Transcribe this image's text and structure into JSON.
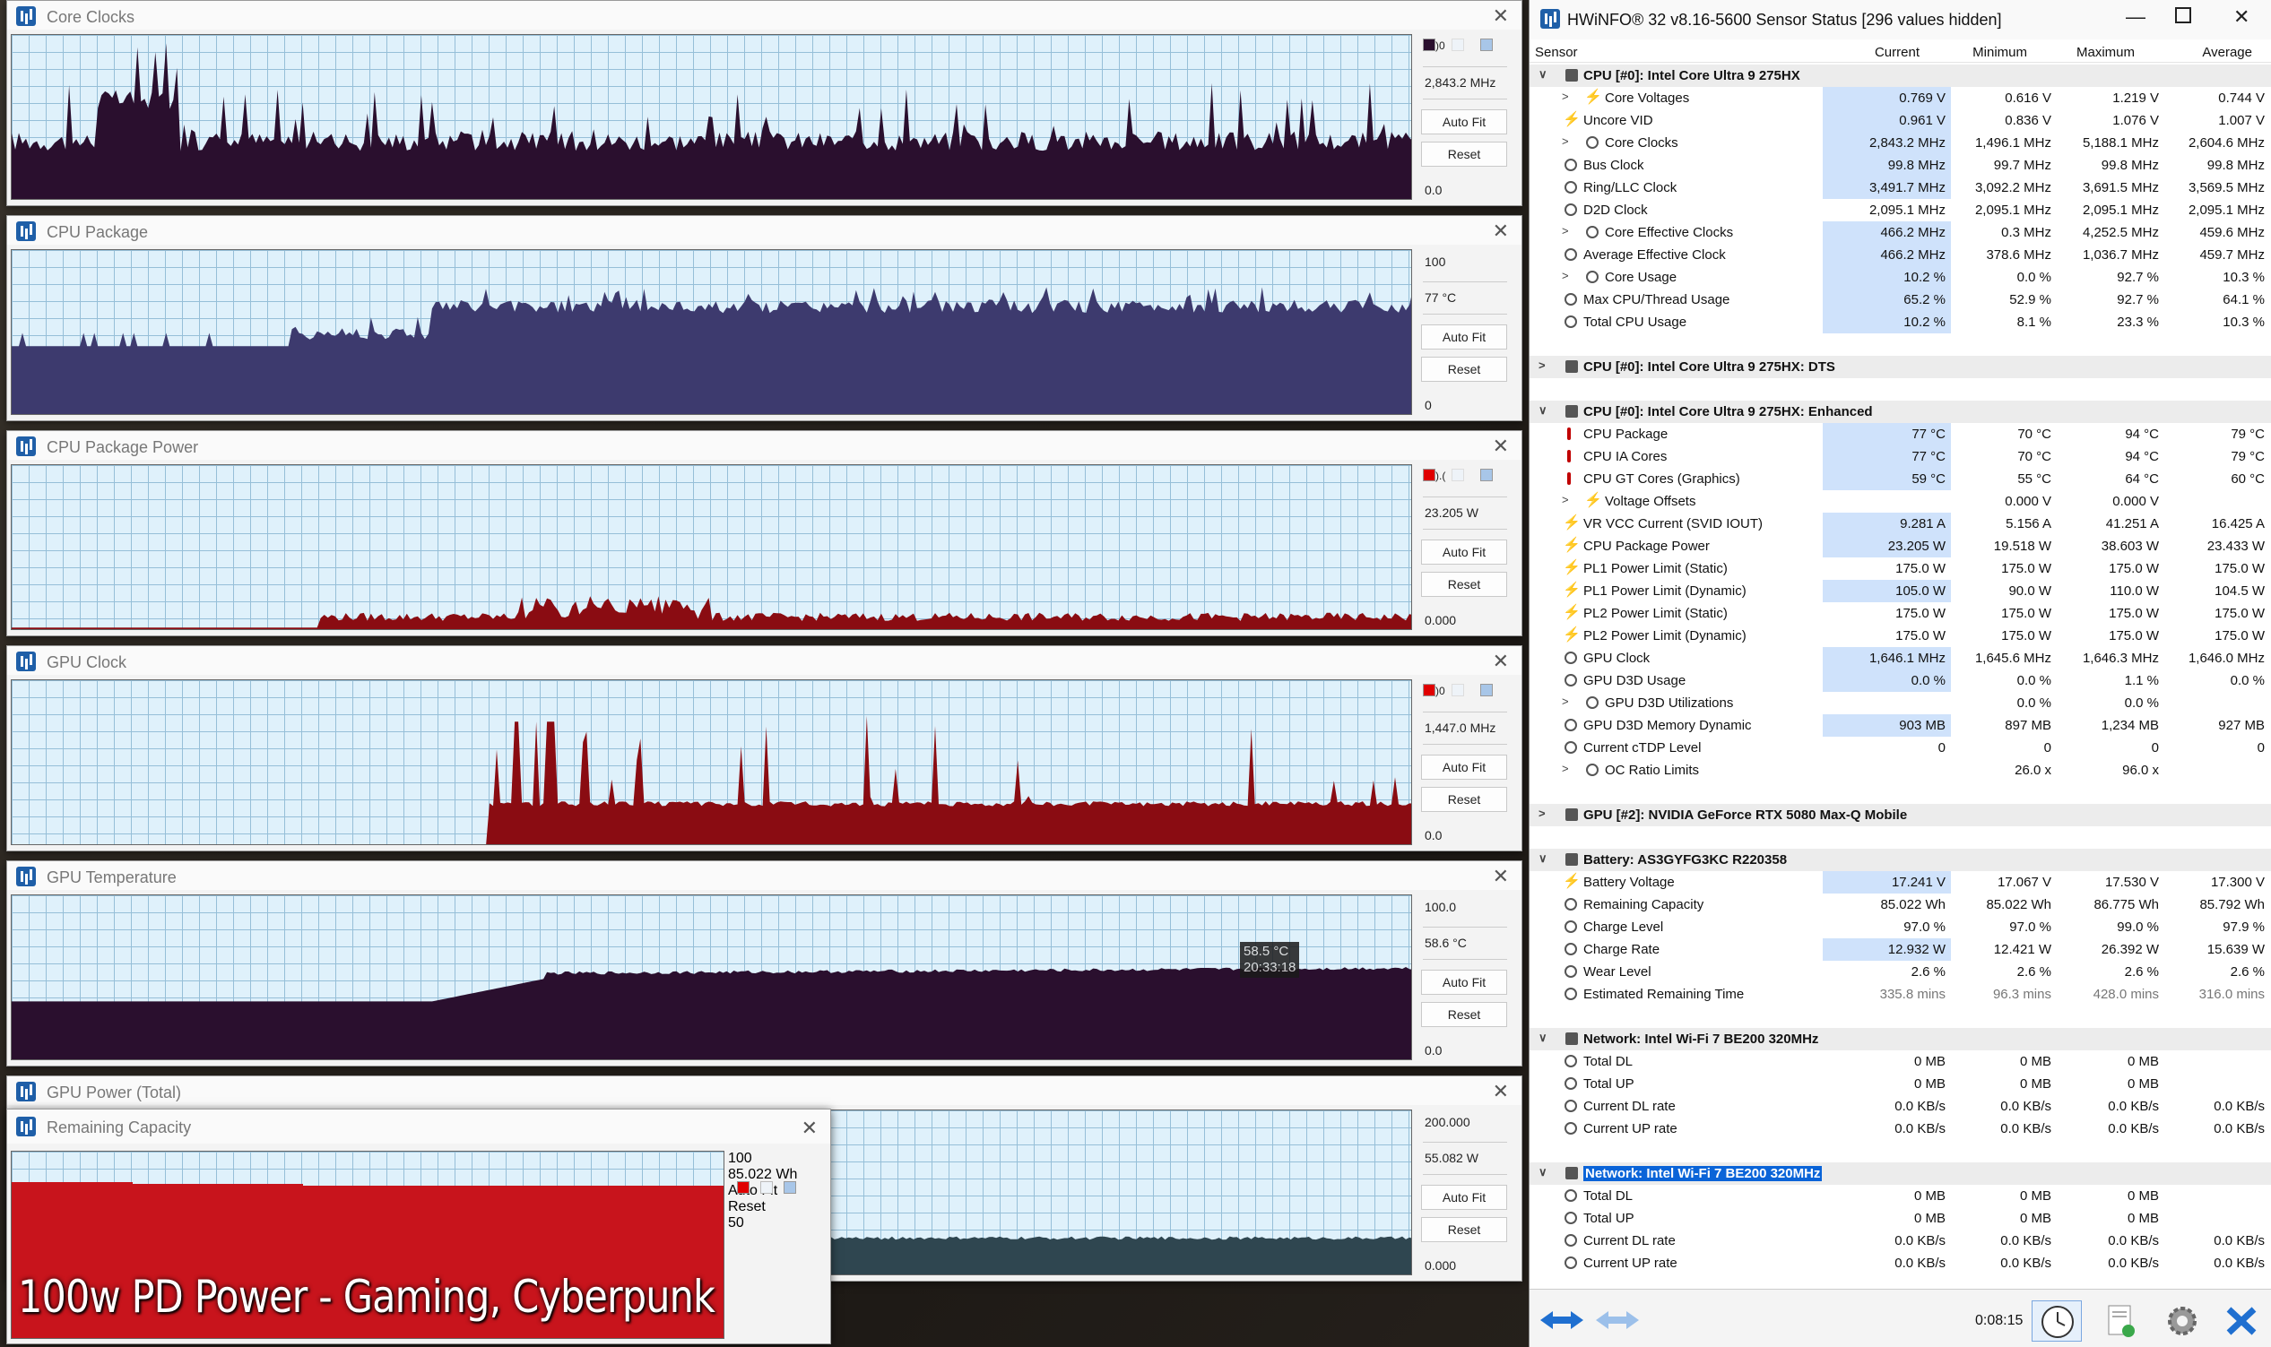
{
  "graphs": [
    {
      "title": "Core Clocks",
      "top_value": "",
      "current_value": "2,843.2 MHz",
      "bottom_value": "0.0",
      "color": "#2a0f2e",
      "auto_fit": "Auto Fit",
      "reset": "Reset",
      "top_label_fragment": ")0"
    },
    {
      "title": "CPU Package",
      "top_value": "100",
      "current_value": "77 °C",
      "bottom_value": "0",
      "color": "#3d3a6e",
      "auto_fit": "Auto Fit",
      "reset": "Reset",
      "top_label_fragment": ""
    },
    {
      "title": "CPU Package Power",
      "top_value": "",
      "current_value": "23.205 W",
      "bottom_value": "0.000",
      "color": "#8a0c12",
      "auto_fit": "Auto Fit",
      "reset": "Reset",
      "top_label_fragment": ").("
    },
    {
      "title": "GPU Clock",
      "top_value": "",
      "current_value": "1,447.0 MHz",
      "bottom_value": "0.0",
      "color": "#8a0c12",
      "auto_fit": "Auto Fit",
      "reset": "Reset",
      "top_label_fragment": ")0"
    },
    {
      "title": "GPU Temperature",
      "top_value": "100.0",
      "current_value": "58.6 °C",
      "bottom_value": "0.0",
      "color": "#2a0f2e",
      "auto_fit": "Auto Fit",
      "reset": "Reset",
      "top_label_fragment": "",
      "tooltip_value": "58.5 °C",
      "tooltip_time": "20:33:18"
    },
    {
      "title": "GPU Power (Total)",
      "top_value": "200.000",
      "current_value": "55.082 W",
      "bottom_value": "0.000",
      "color": "#2f4650",
      "auto_fit": "Auto Fit",
      "reset": "Reset",
      "top_label_fragment": ""
    }
  ],
  "remaining_capacity": {
    "title": "Remaining Capacity",
    "top_value": "100",
    "current_value": "85.022 Wh",
    "bottom_value": "50",
    "auto_fit": "Auto Fit",
    "reset": "Reset",
    "color": "#c8141c"
  },
  "caption": "100w PD Power - Gaming, Cyberpunk",
  "sensor_window": {
    "title": "HWiNFO® 32 v8.16-5600 Sensor Status [296 values hidden]",
    "columns": [
      "Sensor",
      "Current",
      "Minimum",
      "Maximum",
      "Average"
    ],
    "rows": [
      {
        "type": "grp",
        "exp": "∨",
        "label": "CPU [#0]: Intel Core Ultra 9 275HX"
      },
      {
        "type": "sub",
        "exp": ">",
        "icon": "bolt",
        "label": "Core Voltages",
        "cur": "0.769 V",
        "min": "0.616 V",
        "max": "1.219 V",
        "avg": "0.744 V",
        "hl": true
      },
      {
        "type": "item",
        "icon": "bolt",
        "label": "Uncore VID",
        "cur": "0.961 V",
        "min": "0.836 V",
        "max": "1.076 V",
        "avg": "1.007 V",
        "hl": true
      },
      {
        "type": "sub",
        "exp": ">",
        "icon": "clock",
        "label": "Core Clocks",
        "cur": "2,843.2 MHz",
        "min": "1,496.1 MHz",
        "max": "5,188.1 MHz",
        "avg": "2,604.6 MHz",
        "hl": true
      },
      {
        "type": "item",
        "icon": "clock",
        "label": "Bus Clock",
        "cur": "99.8 MHz",
        "min": "99.7 MHz",
        "max": "99.8 MHz",
        "avg": "99.8 MHz",
        "hl": true
      },
      {
        "type": "item",
        "icon": "clock",
        "label": "Ring/LLC Clock",
        "cur": "3,491.7 MHz",
        "min": "3,092.2 MHz",
        "max": "3,691.5 MHz",
        "avg": "3,569.5 MHz",
        "hl": true
      },
      {
        "type": "item",
        "icon": "clock",
        "label": "D2D Clock",
        "cur": "2,095.1 MHz",
        "min": "2,095.1 MHz",
        "max": "2,095.1 MHz",
        "avg": "2,095.1 MHz",
        "hl": false
      },
      {
        "type": "sub",
        "exp": ">",
        "icon": "clock",
        "label": "Core Effective Clocks",
        "cur": "466.2 MHz",
        "min": "0.3 MHz",
        "max": "4,252.5 MHz",
        "avg": "459.6 MHz",
        "hl": true
      },
      {
        "type": "item",
        "icon": "clock",
        "label": "Average Effective Clock",
        "cur": "466.2 MHz",
        "min": "378.6 MHz",
        "max": "1,036.7 MHz",
        "avg": "459.7 MHz",
        "hl": true
      },
      {
        "type": "sub",
        "exp": ">",
        "icon": "clock",
        "label": "Core Usage",
        "cur": "10.2 %",
        "min": "0.0 %",
        "max": "92.7 %",
        "avg": "10.3 %",
        "hl": true
      },
      {
        "type": "item",
        "icon": "clock",
        "label": "Max CPU/Thread Usage",
        "cur": "65.2 %",
        "min": "52.9 %",
        "max": "92.7 %",
        "avg": "64.1 %",
        "hl": true
      },
      {
        "type": "item",
        "icon": "clock",
        "label": "Total CPU Usage",
        "cur": "10.2 %",
        "min": "8.1 %",
        "max": "23.3 %",
        "avg": "10.3 %",
        "hl": true
      },
      {
        "type": "blank"
      },
      {
        "type": "grp",
        "exp": ">",
        "label": "CPU [#0]: Intel Core Ultra 9 275HX: DTS"
      },
      {
        "type": "blank"
      },
      {
        "type": "grp",
        "exp": "∨",
        "label": "CPU [#0]: Intel Core Ultra 9 275HX: Enhanced"
      },
      {
        "type": "item",
        "icon": "therm",
        "label": "CPU Package",
        "cur": "77 °C",
        "min": "70 °C",
        "max": "94 °C",
        "avg": "79 °C",
        "hl": true
      },
      {
        "type": "item",
        "icon": "therm",
        "label": "CPU IA Cores",
        "cur": "77 °C",
        "min": "70 °C",
        "max": "94 °C",
        "avg": "79 °C",
        "hl": true
      },
      {
        "type": "item",
        "icon": "therm",
        "label": "CPU GT Cores (Graphics)",
        "cur": "59 °C",
        "min": "55 °C",
        "max": "64 °C",
        "avg": "60 °C",
        "hl": true
      },
      {
        "type": "sub",
        "exp": ">",
        "icon": "bolt",
        "label": "Voltage Offsets",
        "cur": "",
        "min": "0.000 V",
        "max": "0.000 V",
        "avg": "",
        "hl": false
      },
      {
        "type": "item",
        "icon": "bolt",
        "label": "VR VCC Current (SVID IOUT)",
        "cur": "9.281 A",
        "min": "5.156 A",
        "max": "41.251 A",
        "avg": "16.425 A",
        "hl": true
      },
      {
        "type": "item",
        "icon": "bolt",
        "label": "CPU Package Power",
        "cur": "23.205 W",
        "min": "19.518 W",
        "max": "38.603 W",
        "avg": "23.433 W",
        "hl": true
      },
      {
        "type": "item",
        "icon": "bolt",
        "label": "PL1 Power Limit (Static)",
        "cur": "175.0 W",
        "min": "175.0 W",
        "max": "175.0 W",
        "avg": "175.0 W",
        "hl": false
      },
      {
        "type": "item",
        "icon": "bolt",
        "label": "PL1 Power Limit (Dynamic)",
        "cur": "105.0 W",
        "min": "90.0 W",
        "max": "110.0 W",
        "avg": "104.5 W",
        "hl": true
      },
      {
        "type": "item",
        "icon": "bolt",
        "label": "PL2 Power Limit (Static)",
        "cur": "175.0 W",
        "min": "175.0 W",
        "max": "175.0 W",
        "avg": "175.0 W",
        "hl": false
      },
      {
        "type": "item",
        "icon": "bolt",
        "label": "PL2 Power Limit (Dynamic)",
        "cur": "175.0 W",
        "min": "175.0 W",
        "max": "175.0 W",
        "avg": "175.0 W",
        "hl": false
      },
      {
        "type": "item",
        "icon": "clock",
        "label": "GPU Clock",
        "cur": "1,646.1 MHz",
        "min": "1,645.6 MHz",
        "max": "1,646.3 MHz",
        "avg": "1,646.0 MHz",
        "hl": true
      },
      {
        "type": "item",
        "icon": "clock",
        "label": "GPU D3D Usage",
        "cur": "0.0 %",
        "min": "0.0 %",
        "max": "1.1 %",
        "avg": "0.0 %",
        "hl": true
      },
      {
        "type": "sub",
        "exp": ">",
        "icon": "clock",
        "label": "GPU D3D Utilizations",
        "cur": "",
        "min": "0.0 %",
        "max": "0.0 %",
        "avg": "",
        "hl": false
      },
      {
        "type": "item",
        "icon": "clock",
        "label": "GPU D3D Memory Dynamic",
        "cur": "903 MB",
        "min": "897 MB",
        "max": "1,234 MB",
        "avg": "927 MB",
        "hl": true
      },
      {
        "type": "item",
        "icon": "clock",
        "label": "Current cTDP Level",
        "cur": "0",
        "min": "0",
        "max": "0",
        "avg": "0",
        "hl": false
      },
      {
        "type": "sub",
        "exp": ">",
        "icon": "clock",
        "label": "OC Ratio Limits",
        "cur": "",
        "min": "26.0 x",
        "max": "96.0 x",
        "avg": "",
        "hl": false
      },
      {
        "type": "blank"
      },
      {
        "type": "grp",
        "exp": ">",
        "label": "GPU [#2]: NVIDIA  GeForce RTX 5080 Max-Q Mobile"
      },
      {
        "type": "blank"
      },
      {
        "type": "grp",
        "exp": "∨",
        "label": "Battery: AS3GYFG3KC R220358"
      },
      {
        "type": "item",
        "icon": "bolt",
        "label": "Battery Voltage",
        "cur": "17.241 V",
        "min": "17.067 V",
        "max": "17.530 V",
        "avg": "17.300 V",
        "hl": true
      },
      {
        "type": "item",
        "icon": "clock",
        "label": "Remaining Capacity",
        "cur": "85.022 Wh",
        "min": "85.022 Wh",
        "max": "86.775 Wh",
        "avg": "85.792 Wh",
        "hl": false
      },
      {
        "type": "item",
        "icon": "clock",
        "label": "Charge Level",
        "cur": "97.0 %",
        "min": "97.0 %",
        "max": "99.0 %",
        "avg": "97.9 %",
        "hl": false
      },
      {
        "type": "item",
        "icon": "clock",
        "label": "Charge Rate",
        "cur": "12.932 W",
        "min": "12.421 W",
        "max": "26.392 W",
        "avg": "15.639 W",
        "hl": true
      },
      {
        "type": "item",
        "icon": "clock",
        "label": "Wear Level",
        "cur": "2.6 %",
        "min": "2.6 %",
        "max": "2.6 %",
        "avg": "2.6 %",
        "hl": false
      },
      {
        "type": "item",
        "icon": "clock",
        "label": "Estimated Remaining Time",
        "cur": "335.8 mins",
        "min": "96.3 mins",
        "max": "428.0 mins",
        "avg": "316.0 mins",
        "hl": false,
        "dim": true
      },
      {
        "type": "blank"
      },
      {
        "type": "grp",
        "exp": "∨",
        "label": "Network: Intel Wi-Fi 7 BE200 320MHz"
      },
      {
        "type": "item",
        "icon": "clock",
        "label": "Total DL",
        "cur": "0 MB",
        "min": "0 MB",
        "max": "0 MB",
        "avg": "",
        "hl": false
      },
      {
        "type": "item",
        "icon": "clock",
        "label": "Total UP",
        "cur": "0 MB",
        "min": "0 MB",
        "max": "0 MB",
        "avg": "",
        "hl": false
      },
      {
        "type": "item",
        "icon": "clock",
        "label": "Current DL rate",
        "cur": "0.0 KB/s",
        "min": "0.0 KB/s",
        "max": "0.0 KB/s",
        "avg": "0.0 KB/s",
        "hl": false
      },
      {
        "type": "item",
        "icon": "clock",
        "label": "Current UP rate",
        "cur": "0.0 KB/s",
        "min": "0.0 KB/s",
        "max": "0.0 KB/s",
        "avg": "0.0 KB/s",
        "hl": false
      },
      {
        "type": "blank"
      },
      {
        "type": "grp",
        "exp": "∨",
        "label": "Network: Intel Wi-Fi 7 BE200 320MHz",
        "selected": true
      },
      {
        "type": "item",
        "icon": "clock",
        "label": "Total DL",
        "cur": "0 MB",
        "min": "0 MB",
        "max": "0 MB",
        "avg": "",
        "hl": false
      },
      {
        "type": "item",
        "icon": "clock",
        "label": "Total UP",
        "cur": "0 MB",
        "min": "0 MB",
        "max": "0 MB",
        "avg": "",
        "hl": false
      },
      {
        "type": "item",
        "icon": "clock",
        "label": "Current DL rate",
        "cur": "0.0 KB/s",
        "min": "0.0 KB/s",
        "max": "0.0 KB/s",
        "avg": "0.0 KB/s",
        "hl": false
      },
      {
        "type": "item",
        "icon": "clock",
        "label": "Current UP rate",
        "cur": "0.0 KB/s",
        "min": "0.0 KB/s",
        "max": "0.0 KB/s",
        "avg": "0.0 KB/s",
        "hl": false
      }
    ],
    "footer": {
      "elapsed": "0:08:15",
      "icons": [
        "nav-arrows-icon",
        "nav-arrows-disabled-icon",
        "clock-reset-icon",
        "report-icon",
        "settings-gear-icon",
        "close-x-icon"
      ]
    }
  }
}
